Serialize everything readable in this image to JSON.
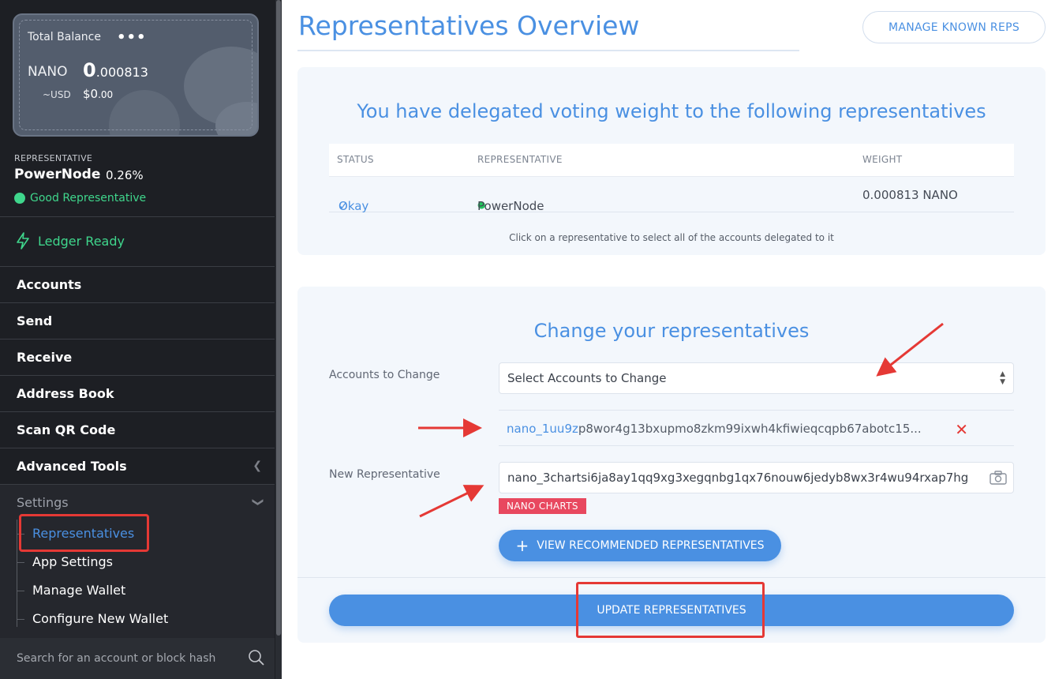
{
  "sidebar": {
    "balance": {
      "label": "Total Balance",
      "menu_icon": "•••",
      "currency": "NANO",
      "value_int": "0",
      "value_dec": ".000813",
      "fiat_label": "~USD",
      "fiat_int": "$0",
      "fiat_dec": ".00"
    },
    "representative": {
      "caption": "REPRESENTATIVE",
      "name": "PowerNode",
      "weight": "0.26%",
      "status": "Good Representative"
    },
    "ledger_status": "Ledger Ready",
    "nav": [
      {
        "label": "Accounts"
      },
      {
        "label": "Send"
      },
      {
        "label": "Receive"
      },
      {
        "label": "Address Book"
      },
      {
        "label": "Scan QR Code"
      },
      {
        "label": "Advanced Tools"
      }
    ],
    "settings": {
      "label": "Settings",
      "items": [
        {
          "label": "Representatives",
          "active": true
        },
        {
          "label": "App Settings"
        },
        {
          "label": "Manage Wallet"
        },
        {
          "label": "Configure New Wallet"
        }
      ]
    },
    "search_placeholder": "Search for an account or block hash"
  },
  "main": {
    "title": "Representatives Overview",
    "manage_button": "MANAGE KNOWN REPS",
    "delegation": {
      "heading": "You have delegated voting weight to the following representatives",
      "columns": [
        "STATUS",
        "REPRESENTATIVE",
        "WEIGHT"
      ],
      "rows": [
        {
          "status": "Okay",
          "representative": "PowerNode",
          "weight": "0.000813 NANO"
        }
      ],
      "hint": "Click on a representative to select all of the accounts delegated to it"
    },
    "change": {
      "heading": "Change your representatives",
      "accounts_label": "Accounts to Change",
      "accounts_select": "Select Accounts to Change",
      "selected_account_prefix": "nano_1uu9z",
      "selected_account_rest": "p8wor4g13bxupmo8zkm99ixwh4kfiwieqcqpb67abotc15...",
      "new_rep_label": "New Representative",
      "new_rep_value": "nano_3chartsi6ja8ay1qq9xg3xegqnbg1qx76nouw6jedyb8wx3r4wu94rxap7hg",
      "rep_tag": "NANO CHARTS",
      "recommend_button": "VIEW RECOMMENDED REPRESENTATIVES",
      "update_button": "UPDATE REPRESENTATIVES"
    }
  },
  "colors": {
    "accent": "#4a90e2",
    "sidebar_bg": "#1d1f24",
    "good": "#3fd68c",
    "annotation_red": "#e53935",
    "tag_red": "#e8485f"
  }
}
